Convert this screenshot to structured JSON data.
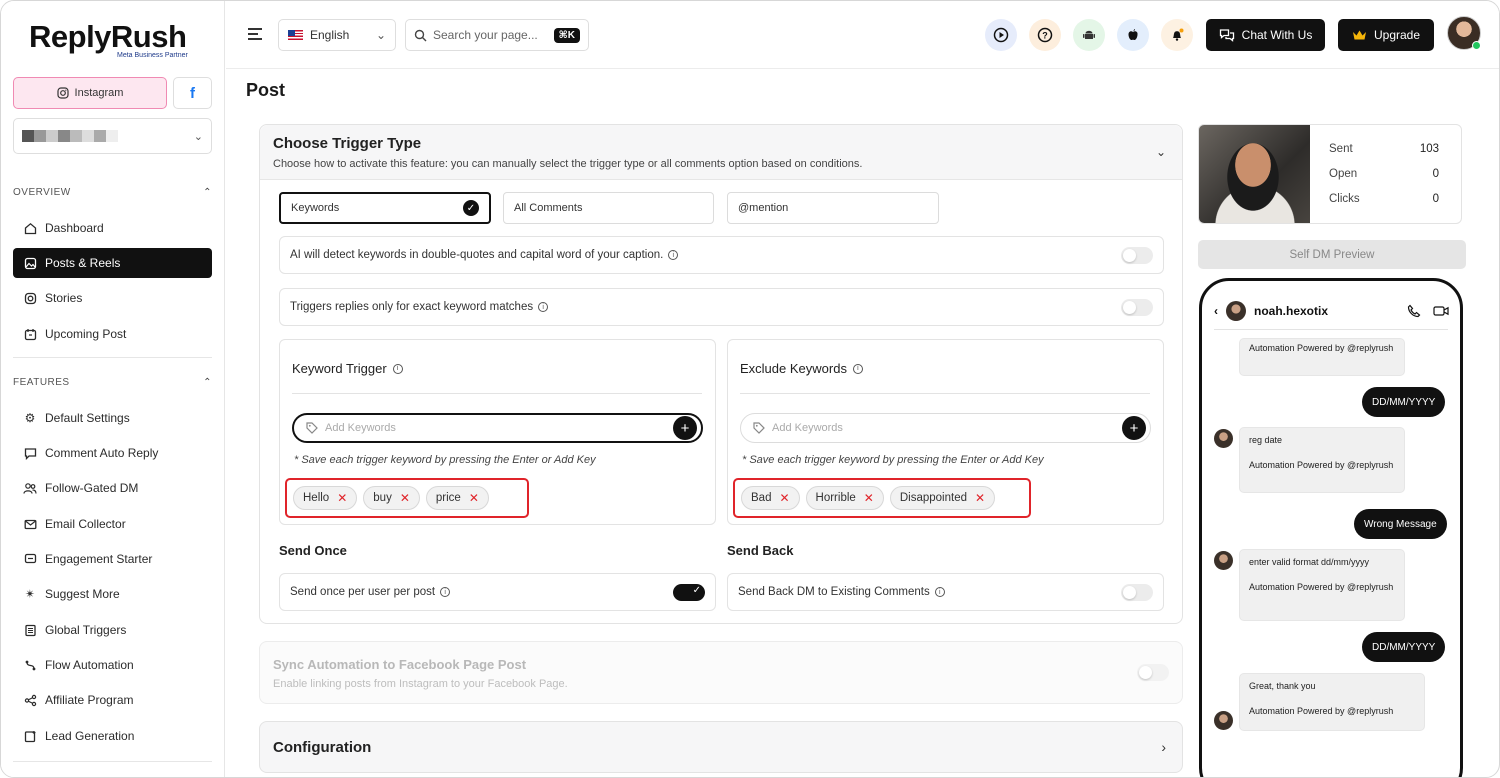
{
  "app": {
    "logo": "ReplyRush",
    "partner_badge": "Meta Business Partner"
  },
  "sidebar": {
    "instagram_label": "Instagram",
    "facebook_label": "f",
    "overview_label": "OVERVIEW",
    "features_label": "FEATURES",
    "overview_items": [
      {
        "label": "Dashboard",
        "icon": "home-icon"
      },
      {
        "label": "Posts & Reels",
        "icon": "image-icon",
        "active": true
      },
      {
        "label": "Stories",
        "icon": "instagram-icon"
      },
      {
        "label": "Upcoming Post",
        "icon": "calendar-icon"
      }
    ],
    "feature_items": [
      {
        "label": "Default Settings",
        "icon": "gear-icon"
      },
      {
        "label": "Comment Auto Reply",
        "icon": "comment-icon"
      },
      {
        "label": "Follow-Gated DM",
        "icon": "users-icon"
      },
      {
        "label": "Email Collector",
        "icon": "mail-icon"
      },
      {
        "label": "Engagement Starter",
        "icon": "chat-icon"
      },
      {
        "label": "Suggest More",
        "icon": "sparkle-icon"
      },
      {
        "label": "Global Triggers",
        "icon": "list-icon"
      },
      {
        "label": "Flow Automation",
        "icon": "flow-icon"
      },
      {
        "label": "Affiliate Program",
        "icon": "share-icon"
      },
      {
        "label": "Lead Generation",
        "icon": "lead-icon"
      }
    ]
  },
  "topbar": {
    "language": "English",
    "search_placeholder": "Search your page...",
    "search_shortcut": "⌘K",
    "chat_label": "Chat With Us",
    "upgrade_label": "Upgrade",
    "colors": {
      "play_bg": "#e6ecfb",
      "help_bg": "#fdeedd",
      "android_bg": "#e4f6e7",
      "apple_bg": "#e3eefc",
      "bell_bg": "#fdf1e2",
      "bell_dot": "#f59e0b"
    }
  },
  "main": {
    "page_title": "Post",
    "trigger": {
      "title": "Choose Trigger Type",
      "subtitle": "Choose how to activate this feature: you can manually select the trigger type or all comments option based on conditions.",
      "options": [
        "Keywords",
        "All Comments",
        "@mention"
      ],
      "selected": "Keywords",
      "ai_detect_label": "AI will detect keywords in double-quotes and capital word of your caption.",
      "exact_match_label": "Triggers replies only for exact keyword matches"
    },
    "keyword_trigger": {
      "title": "Keyword Trigger",
      "placeholder": "Add Keywords",
      "hint": "* Save each trigger keyword by pressing the Enter or Add Key",
      "chips": [
        "Hello",
        "buy",
        "price"
      ]
    },
    "exclude_keywords": {
      "title": "Exclude Keywords",
      "placeholder": "Add Keywords",
      "hint": "* Save each trigger keyword by pressing the Enter or Add Key",
      "chips": [
        "Bad",
        "Horrible",
        "Disappointed"
      ]
    },
    "send_once": {
      "title": "Send Once",
      "label": "Send once per user per post",
      "enabled": true
    },
    "send_back": {
      "title": "Send Back",
      "label": "Send Back DM to Existing Comments",
      "enabled": false
    },
    "sync": {
      "title": "Sync Automation to Facebook Page Post",
      "subtitle": "Enable linking posts from Instagram to your Facebook Page."
    },
    "configuration": {
      "title": "Configuration"
    }
  },
  "right": {
    "stats": [
      {
        "label": "Sent",
        "value": "103"
      },
      {
        "label": "Open",
        "value": "0"
      },
      {
        "label": "Clicks",
        "value": "0"
      }
    ],
    "preview_button": "Self DM Preview",
    "phone": {
      "username": "noah.hexotix",
      "messages": [
        {
          "from": "bot",
          "text": "Automation Powered by @replyrush"
        },
        {
          "from": "user",
          "text": "DD/MM/YYYY"
        },
        {
          "from": "bot",
          "text": "reg date",
          "footer": "Automation Powered by @replyrush"
        },
        {
          "from": "user",
          "text": "Wrong Message"
        },
        {
          "from": "bot",
          "text": "enter valid format dd/mm/yyyy",
          "footer": "Automation Powered by @replyrush"
        },
        {
          "from": "user",
          "text": "DD/MM/YYYY"
        },
        {
          "from": "bot",
          "text": "Great, thank you",
          "footer": "Automation Powered by @replyrush"
        }
      ]
    }
  }
}
